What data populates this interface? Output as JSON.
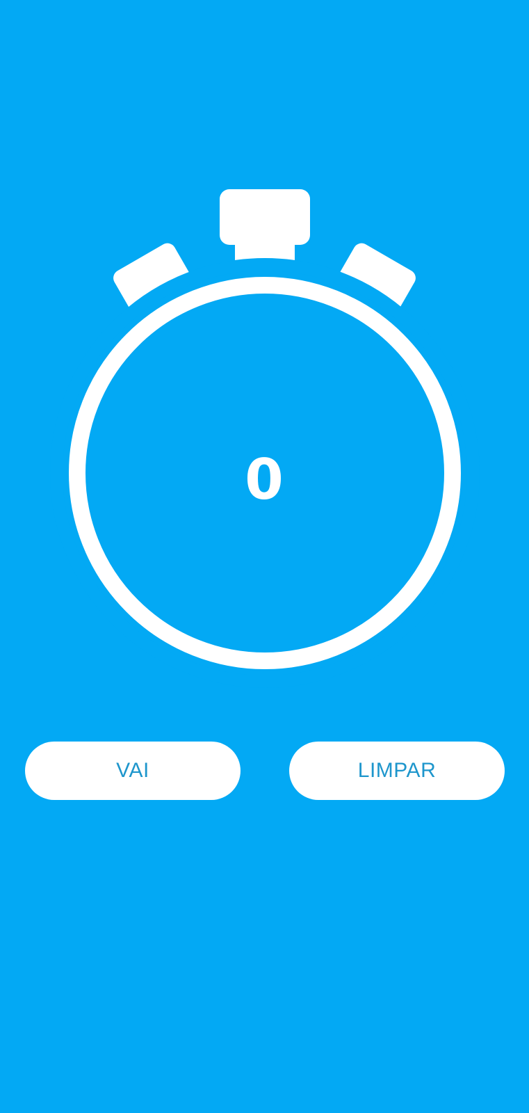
{
  "theme": {
    "background": "#03A9F4",
    "foreground": "#FFFFFF",
    "button_text": "#1E96CC"
  },
  "stopwatch": {
    "icon": "stopwatch-icon",
    "value": "0"
  },
  "actions": {
    "start_label": "VAI",
    "clear_label": "LIMPAR"
  }
}
